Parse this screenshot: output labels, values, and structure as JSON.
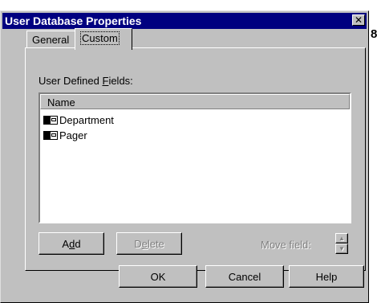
{
  "window": {
    "title": "User Database Properties",
    "close_glyph": "✕"
  },
  "edge_char": "8",
  "tabs": [
    {
      "label": "General",
      "active": false
    },
    {
      "label": "Custom",
      "active": true
    }
  ],
  "custom": {
    "fields_label_pre": "User Defined ",
    "fields_label_u": "F",
    "fields_label_post": "ields:",
    "column_header": "Name",
    "items": [
      {
        "icon": "field-icon",
        "label": "Department"
      },
      {
        "icon": "field-icon",
        "label": "Pager"
      }
    ],
    "add": {
      "pre": "A",
      "u": "d",
      "post": "d"
    },
    "delete": {
      "pre": "D",
      "u": "e",
      "post": "lete",
      "enabled": false
    },
    "move_field_label": "Move field:",
    "move_up_glyph": "▲",
    "move_down_glyph": "▼"
  },
  "footer": {
    "ok_label": "OK",
    "cancel_label": "Cancel",
    "help_label": "Help"
  }
}
